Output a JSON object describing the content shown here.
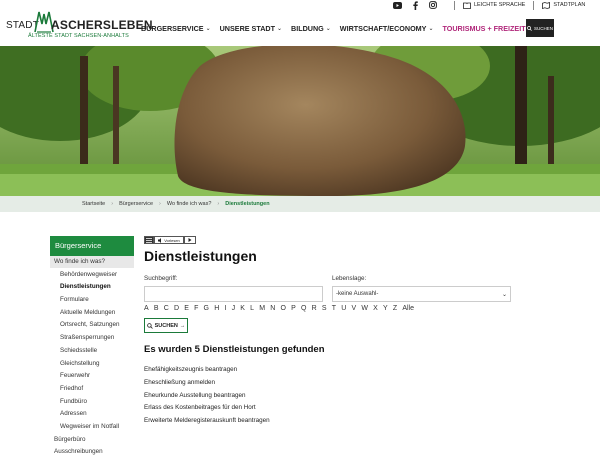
{
  "header": {
    "logo": {
      "stadt": "STADT",
      "name": "ASCHERSLEBEN",
      "subtitle": "ÄLTESTE STADT SACHSEN-ANHALTS"
    },
    "top_links": {
      "easy_language": "LEICHTE SPRACHE",
      "city_map": "STADTPLAN"
    },
    "nav": [
      {
        "label": "BÜRGERSERVICE"
      },
      {
        "label": "UNSERE STADT"
      },
      {
        "label": "BILDUNG"
      },
      {
        "label": "WIRTSCHAFT/ECONOMY"
      },
      {
        "label": "TOURISMUS + FREIZEIT"
      }
    ],
    "search_label": "SUCHEN"
  },
  "breadcrumb": [
    "Startseite",
    "Bürgerservice",
    "Wo finde ich was?",
    "Dienstleistungen"
  ],
  "sidebar": {
    "title": "Bürgerservice",
    "items": [
      {
        "label": "Wo finde ich was?"
      },
      {
        "label": "Behördenwegweiser"
      },
      {
        "label": "Dienstleistungen"
      },
      {
        "label": "Formulare"
      },
      {
        "label": "Aktuelle Meldungen"
      },
      {
        "label": "Ortsrecht, Satzungen"
      },
      {
        "label": "Straßensperrungen"
      },
      {
        "label": "Schiedsstelle"
      },
      {
        "label": "Gleichstellung"
      },
      {
        "label": "Feuerwehr"
      },
      {
        "label": "Friedhof"
      },
      {
        "label": "Fundbüro"
      },
      {
        "label": "Adressen"
      },
      {
        "label": "Wegweiser im Notfall"
      },
      {
        "label": "Bürgerbüro"
      },
      {
        "label": "Ausschreibungen"
      }
    ]
  },
  "main": {
    "readspeaker": "Vorlesen",
    "title": "Dienstleistungen",
    "search_label": "Suchbegriff:",
    "search_value": "",
    "lebenslage_label": "Lebenslage:",
    "lebenslage_value": "-keine Auswahl-",
    "alphabet": [
      "A",
      "B",
      "C",
      "D",
      "E",
      "F",
      "G",
      "H",
      "I",
      "J",
      "K",
      "L",
      "M",
      "N",
      "O",
      "P",
      "Q",
      "R",
      "S",
      "T",
      "U",
      "V",
      "W",
      "X",
      "Y",
      "Z",
      "Alle"
    ],
    "search_button": "SUCHEN",
    "results_heading": "Es wurden 5 Dienstleistungen gefunden",
    "results": [
      "Ehefähigkeitszeugnis beantragen",
      "Eheschließung anmelden",
      "Eheurkunde Ausstellung beantragen",
      "Erlass des Kostenbeitrages für den Hort",
      "Erweiterte Melderegisterauskunft beantragen"
    ]
  },
  "colors": {
    "brand_green": "#1e8b3f",
    "tourism_pink": "#b0277a",
    "breadcrumb_bg": "#e5ece6"
  }
}
